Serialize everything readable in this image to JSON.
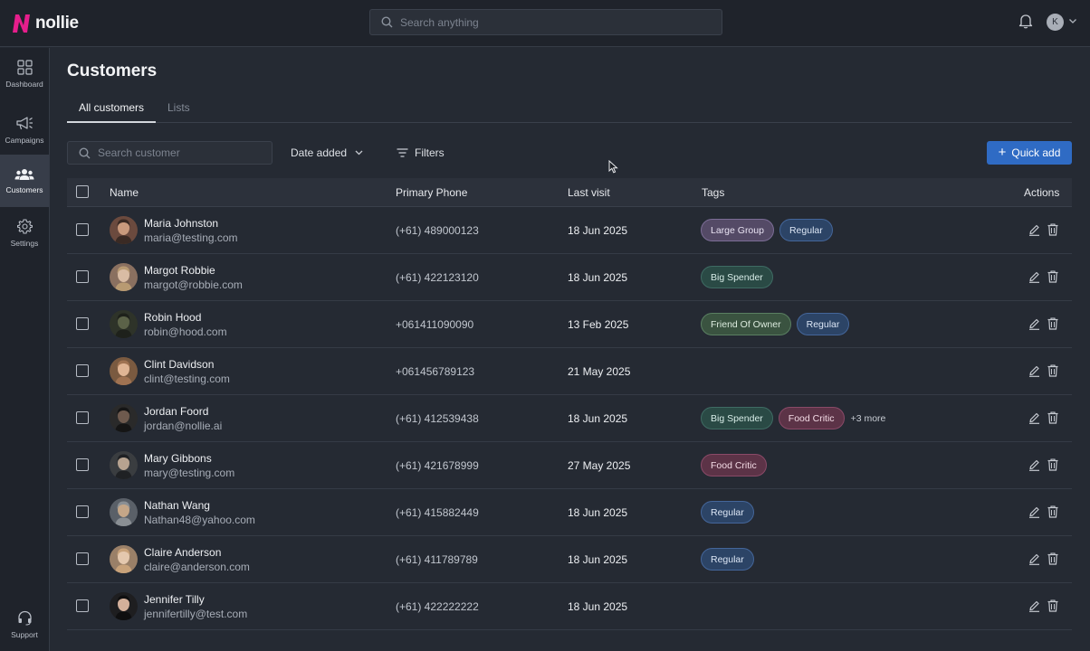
{
  "app": {
    "name": "nollie",
    "brand_color": "#e61e8c"
  },
  "header": {
    "search_placeholder": "Search anything",
    "user_initial": "K",
    "icons": [
      "search-icon",
      "bell-icon",
      "chevron-down-icon"
    ]
  },
  "sidebar": {
    "items": [
      {
        "label": "Dashboard",
        "icon": "grid-icon",
        "active": false
      },
      {
        "label": "Campaigns",
        "icon": "megaphone-icon",
        "active": false
      },
      {
        "label": "Customers",
        "icon": "users-icon",
        "active": true
      },
      {
        "label": "Settings",
        "icon": "gear-icon",
        "active": false
      }
    ],
    "support": {
      "label": "Support",
      "icon": "headset-icon"
    }
  },
  "page": {
    "title": "Customers",
    "tabs": [
      {
        "label": "All customers",
        "active": true
      },
      {
        "label": "Lists",
        "active": false
      }
    ]
  },
  "toolbar": {
    "search_placeholder": "Search customer",
    "sort_label": "Date added",
    "filters_label": "Filters",
    "quick_add_label": "Quick add",
    "accent_color": "#2f6bc4"
  },
  "table": {
    "columns": [
      "Name",
      "Primary Phone",
      "Last visit",
      "Tags",
      "Actions"
    ],
    "rows": [
      {
        "name": "Maria Johnston",
        "email": "maria@testing.com",
        "phone": "(+61) 489000123",
        "last_visit": "18 Jun 2025",
        "tags": [
          {
            "label": "Large Group",
            "kind": "large-group"
          },
          {
            "label": "Regular",
            "kind": "regular"
          }
        ],
        "more": ""
      },
      {
        "name": "Margot Robbie",
        "email": "margot@robbie.com",
        "phone": "(+61) 422123120",
        "last_visit": "18 Jun 2025",
        "tags": [
          {
            "label": "Big Spender",
            "kind": "big-spender"
          }
        ],
        "more": ""
      },
      {
        "name": "Robin Hood",
        "email": "robin@hood.com",
        "phone": "+061411090090",
        "last_visit": "13 Feb 2025",
        "tags": [
          {
            "label": "Friend Of Owner",
            "kind": "friend"
          },
          {
            "label": "Regular",
            "kind": "regular"
          }
        ],
        "more": ""
      },
      {
        "name": "Clint Davidson",
        "email": "clint@testing.com",
        "phone": "+061456789123",
        "last_visit": "21 May 2025",
        "tags": [],
        "more": ""
      },
      {
        "name": "Jordan Foord",
        "email": "jordan@nollie.ai",
        "phone": "(+61) 412539438",
        "last_visit": "18 Jun 2025",
        "tags": [
          {
            "label": "Big Spender",
            "kind": "big-spender"
          },
          {
            "label": "Food Critic",
            "kind": "critic"
          }
        ],
        "more": "+3 more"
      },
      {
        "name": "Mary Gibbons",
        "email": "mary@testing.com",
        "phone": "(+61) 421678999",
        "last_visit": "27 May 2025",
        "tags": [
          {
            "label": "Food Critic",
            "kind": "critic"
          }
        ],
        "more": ""
      },
      {
        "name": "Nathan Wang",
        "email": "Nathan48@yahoo.com",
        "phone": "(+61) 415882449",
        "last_visit": "18 Jun 2025",
        "tags": [
          {
            "label": "Regular",
            "kind": "regular"
          }
        ],
        "more": ""
      },
      {
        "name": "Claire Anderson",
        "email": "claire@anderson.com",
        "phone": "(+61) 411789789",
        "last_visit": "18 Jun 2025",
        "tags": [
          {
            "label": "Regular",
            "kind": "regular"
          }
        ],
        "more": ""
      },
      {
        "name": "Jennifer Tilly",
        "email": "jennifertilly@test.com",
        "phone": "(+61) 422222222",
        "last_visit": "18 Jun 2025",
        "tags": [],
        "more": ""
      }
    ],
    "action_icons": [
      "edit-icon",
      "trash-icon"
    ]
  }
}
